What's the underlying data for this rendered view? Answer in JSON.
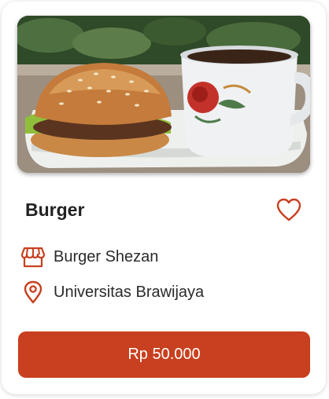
{
  "product": {
    "name": "Burger",
    "shop": "Burger Shezan",
    "location": "Universitas Brawijaya",
    "price": "Rp 50.000"
  },
  "icons": {
    "favorite": "heart-outline-icon",
    "shop": "storefront-icon",
    "location": "map-pin-icon"
  },
  "colors": {
    "accent": "#c8401f"
  }
}
